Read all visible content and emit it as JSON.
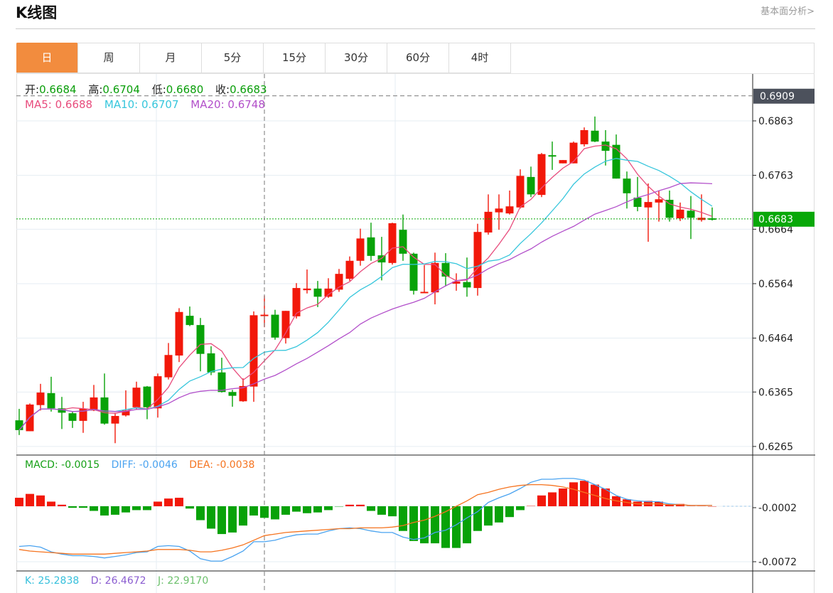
{
  "header": {
    "title": "K线图",
    "link": "基本面分析>"
  },
  "tabs": [
    {
      "label": "日",
      "active": true
    },
    {
      "label": "周"
    },
    {
      "label": "月"
    },
    {
      "label": "5分"
    },
    {
      "label": "15分"
    },
    {
      "label": "30分"
    },
    {
      "label": "60分"
    },
    {
      "label": "4时"
    }
  ],
  "ohlc_info": {
    "open_label": "开:",
    "open": "0.6684",
    "high_label": "高:",
    "high": "0.6704",
    "low_label": "低:",
    "low": "0.6680",
    "close_label": "收:",
    "close": "0.6683"
  },
  "ma_info": {
    "ma5_label": "MA5:",
    "ma5": "0.6688",
    "ma10_label": "MA10:",
    "ma10": "0.6707",
    "ma20_label": "MA20:",
    "ma20": "0.6748"
  },
  "macd_info": {
    "macd_label": "MACD:",
    "macd": "-0.0015",
    "diff_label": "DIFF:",
    "diff": "-0.0046",
    "dea_label": "DEA:",
    "dea": "-0.0038"
  },
  "kdj_info": {
    "k_label": "K:",
    "k": "25.2838",
    "d_label": "D:",
    "d": "26.4672",
    "j_label": "J:",
    "j": "22.9170"
  },
  "colors": {
    "up": "#f2180a",
    "down": "#08a208",
    "ma5": "#e84c7d",
    "ma10": "#36c6dc",
    "ma20": "#b24fca",
    "diff": "#4aa3f0",
    "dea": "#f57420",
    "tab_active": "#f28c3e",
    "last_price_tag": "#08a808",
    "crosshair_tag": "#4c515c",
    "k": "#36c0dc",
    "d": "#8a5cd0",
    "j": "#6cc06c"
  },
  "chart_data": [
    {
      "type": "candlestick",
      "title": "",
      "y_ticks": [
        "0.6863",
        "0.6763",
        "0.6664",
        "0.6564",
        "0.6464",
        "0.6365",
        "0.6265"
      ],
      "ylim": [
        0.6265,
        0.6909
      ],
      "crosshair": {
        "price": "0.6909",
        "candle_index": 24
      },
      "last_price": "0.6683",
      "grid": true,
      "ohlc_fields": [
        "open",
        "high",
        "low",
        "close"
      ],
      "candles": [
        [
          0.6313,
          0.6334,
          0.6286,
          0.6295
        ],
        [
          0.6293,
          0.6344,
          0.6293,
          0.6342
        ],
        [
          0.6341,
          0.638,
          0.6331,
          0.6364
        ],
        [
          0.6363,
          0.6393,
          0.6329,
          0.6335
        ],
        [
          0.6335,
          0.6356,
          0.6297,
          0.6327
        ],
        [
          0.6326,
          0.633,
          0.6299,
          0.6312
        ],
        [
          0.6312,
          0.6347,
          0.629,
          0.6334
        ],
        [
          0.6331,
          0.6378,
          0.633,
          0.6355
        ],
        [
          0.6355,
          0.6399,
          0.6305,
          0.6307
        ],
        [
          0.6307,
          0.6327,
          0.6271,
          0.6321
        ],
        [
          0.6322,
          0.6368,
          0.632,
          0.6331
        ],
        [
          0.6337,
          0.6384,
          0.6333,
          0.6373
        ],
        [
          0.6375,
          0.6376,
          0.6315,
          0.6337
        ],
        [
          0.6335,
          0.6399,
          0.6318,
          0.6394
        ],
        [
          0.6392,
          0.6455,
          0.6388,
          0.6433
        ],
        [
          0.6432,
          0.6519,
          0.642,
          0.6512
        ],
        [
          0.6505,
          0.6522,
          0.6486,
          0.6488
        ],
        [
          0.6488,
          0.6501,
          0.6403,
          0.6435
        ],
        [
          0.6436,
          0.6449,
          0.6396,
          0.6401
        ],
        [
          0.6401,
          0.6428,
          0.6364,
          0.6365
        ],
        [
          0.6365,
          0.6369,
          0.6338,
          0.6358
        ],
        [
          0.6348,
          0.639,
          0.6347,
          0.6376
        ],
        [
          0.6375,
          0.6513,
          0.6347,
          0.6506
        ],
        [
          0.6505,
          0.6542,
          0.6484,
          0.6507
        ],
        [
          0.6507,
          0.6516,
          0.6461,
          0.6465
        ],
        [
          0.6464,
          0.6514,
          0.6454,
          0.6514
        ],
        [
          0.6504,
          0.6565,
          0.65,
          0.6556
        ],
        [
          0.6552,
          0.659,
          0.6546,
          0.6555
        ],
        [
          0.6555,
          0.6569,
          0.6521,
          0.654
        ],
        [
          0.654,
          0.6574,
          0.6538,
          0.6555
        ],
        [
          0.6553,
          0.6591,
          0.6549,
          0.6582
        ],
        [
          0.6573,
          0.6614,
          0.6569,
          0.6606
        ],
        [
          0.6606,
          0.6665,
          0.6597,
          0.6647
        ],
        [
          0.6649,
          0.6676,
          0.6606,
          0.6615
        ],
        [
          0.6616,
          0.665,
          0.657,
          0.6603
        ],
        [
          0.6602,
          0.6676,
          0.6599,
          0.6675
        ],
        [
          0.6663,
          0.6691,
          0.6606,
          0.6619
        ],
        [
          0.6619,
          0.6621,
          0.6544,
          0.6551
        ],
        [
          0.6548,
          0.6598,
          0.6547,
          0.6549
        ],
        [
          0.6548,
          0.6621,
          0.6526,
          0.6602
        ],
        [
          0.6602,
          0.662,
          0.6559,
          0.6577
        ],
        [
          0.6564,
          0.6583,
          0.6551,
          0.6568
        ],
        [
          0.6567,
          0.6612,
          0.654,
          0.6557
        ],
        [
          0.6556,
          0.6674,
          0.6542,
          0.6659
        ],
        [
          0.6658,
          0.6728,
          0.6654,
          0.6696
        ],
        [
          0.6695,
          0.6728,
          0.6663,
          0.6702
        ],
        [
          0.6693,
          0.6735,
          0.6691,
          0.6706
        ],
        [
          0.6704,
          0.6774,
          0.6702,
          0.6762
        ],
        [
          0.676,
          0.6779,
          0.6723,
          0.6728
        ],
        [
          0.6727,
          0.6804,
          0.6723,
          0.6802
        ],
        [
          0.68,
          0.6825,
          0.6773,
          0.6798
        ],
        [
          0.6785,
          0.6791,
          0.6785,
          0.6791
        ],
        [
          0.6785,
          0.6825,
          0.6785,
          0.6823
        ],
        [
          0.682,
          0.6851,
          0.6816,
          0.6846
        ],
        [
          0.6845,
          0.6871,
          0.6824,
          0.6825
        ],
        [
          0.6825,
          0.6846,
          0.6781,
          0.6808
        ],
        [
          0.6819,
          0.6838,
          0.6757,
          0.6757
        ],
        [
          0.6757,
          0.677,
          0.6702,
          0.673
        ],
        [
          0.6722,
          0.676,
          0.6697,
          0.6705
        ],
        [
          0.6704,
          0.6748,
          0.6641,
          0.6714
        ],
        [
          0.6713,
          0.6735,
          0.6678,
          0.6719
        ],
        [
          0.6718,
          0.6735,
          0.6678,
          0.6685
        ],
        [
          0.6684,
          0.6713,
          0.6679,
          0.67
        ],
        [
          0.6698,
          0.6725,
          0.6646,
          0.6685
        ],
        [
          0.6681,
          0.6728,
          0.6678,
          0.6685
        ],
        [
          0.6684,
          0.6704,
          0.668,
          0.6683
        ]
      ],
      "moving_averages": [
        5,
        10,
        20
      ]
    },
    {
      "type": "bar+line",
      "title": "",
      "y_ticks": [
        "-0.0002",
        "-0.0072"
      ],
      "histogram": [
        0.0011,
        0.0016,
        0.0014,
        0.0006,
        0.0002,
        -0.0002,
        -0.0002,
        -0.0006,
        -0.0012,
        -0.0011,
        -0.0008,
        -0.0005,
        -0.0005,
        0.0006,
        0.001,
        0.0011,
        -0.0003,
        -0.0018,
        -0.0029,
        -0.0036,
        -0.0034,
        -0.0025,
        -0.0012,
        -0.0015,
        -0.0017,
        -0.0011,
        -0.0007,
        -0.0009,
        -0.0008,
        -0.0005,
        -0.0001,
        0.0002,
        0.0002,
        -0.0006,
        -0.0011,
        -0.0013,
        -0.0032,
        -0.0045,
        -0.0048,
        -0.0048,
        -0.0054,
        -0.0054,
        -0.0048,
        -0.0032,
        -0.0025,
        -0.0021,
        -0.0014,
        -0.0005,
        0.0001,
        0.0014,
        0.0018,
        0.0023,
        0.0031,
        0.0033,
        0.0028,
        0.0023,
        0.0013,
        0.0009,
        0.0006,
        0.0007,
        0.0006,
        0.0002,
        0.0003,
        0.0001,
        0.0001,
        0.0
      ],
      "diff": [
        -0.0052,
        -0.0051,
        -0.0053,
        -0.0059,
        -0.0062,
        -0.0064,
        -0.0064,
        -0.0065,
        -0.0067,
        -0.0065,
        -0.0063,
        -0.006,
        -0.0059,
        -0.0052,
        -0.0051,
        -0.0052,
        -0.0058,
        -0.0068,
        -0.0071,
        -0.0071,
        -0.0065,
        -0.0058,
        -0.0046,
        -0.0046,
        -0.0044,
        -0.004,
        -0.0037,
        -0.0036,
        -0.0036,
        -0.0032,
        -0.0029,
        -0.0028,
        -0.0029,
        -0.0032,
        -0.0034,
        -0.0034,
        -0.004,
        -0.0043,
        -0.0041,
        -0.0034,
        -0.0031,
        -0.0024,
        -0.0015,
        -0.0007,
        0.0005,
        0.0011,
        0.0016,
        0.0023,
        0.0031,
        0.0035,
        0.0035,
        0.0036,
        0.0036,
        0.0034,
        0.0028,
        0.0022,
        0.0014,
        0.0009,
        0.0007,
        0.0006,
        0.0006,
        0.0003,
        0.0002,
        0.0001,
        0.0001,
        0.0001
      ],
      "dea": [
        -0.0056,
        -0.0058,
        -0.0059,
        -0.006,
        -0.0061,
        -0.0062,
        -0.0062,
        -0.0062,
        -0.0062,
        -0.0061,
        -0.006,
        -0.0059,
        -0.0058,
        -0.0056,
        -0.0056,
        -0.0056,
        -0.0057,
        -0.0059,
        -0.0059,
        -0.0057,
        -0.0054,
        -0.005,
        -0.0044,
        -0.0038,
        -0.0036,
        -0.0034,
        -0.0033,
        -0.0032,
        -0.0031,
        -0.003,
        -0.0029,
        -0.0029,
        -0.0028,
        -0.0028,
        -0.0028,
        -0.0027,
        -0.0025,
        -0.0021,
        -0.0018,
        -0.0013,
        -0.0007,
        0.0,
        0.0007,
        0.0015,
        0.0018,
        0.0022,
        0.0025,
        0.0027,
        0.0028,
        0.0028,
        0.0027,
        0.0025,
        0.0022,
        0.0018,
        0.0014,
        0.001,
        0.0007,
        0.0005,
        0.0003,
        0.0003,
        0.0003,
        0.0002,
        0.0002,
        0.0001,
        0.0001,
        0.0001
      ]
    }
  ]
}
